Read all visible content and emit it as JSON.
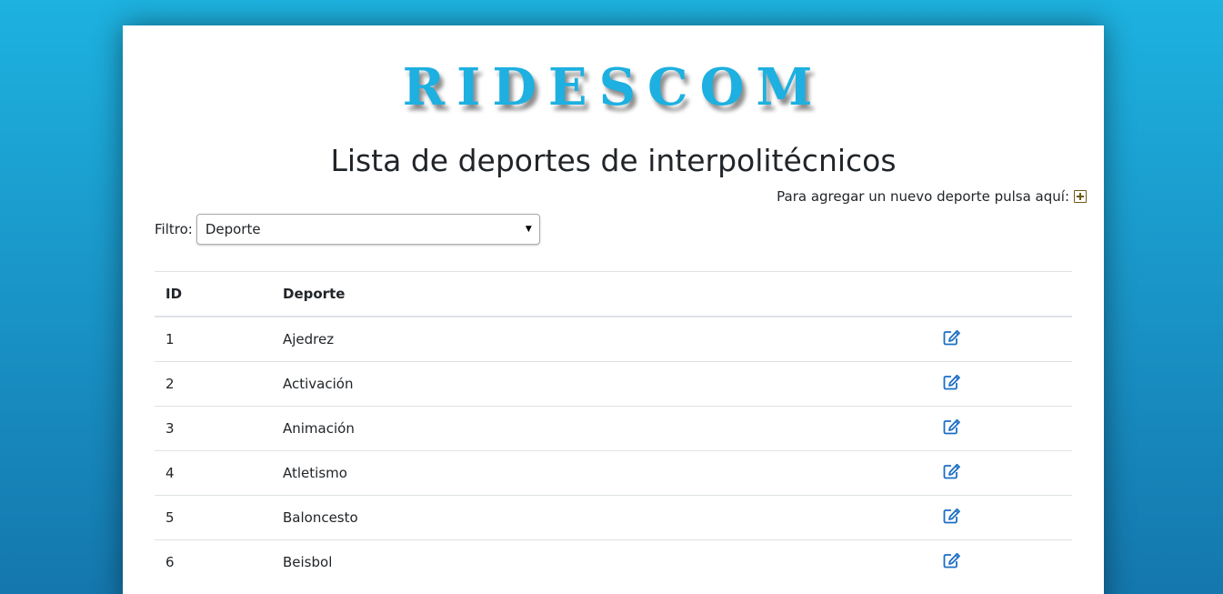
{
  "brand": {
    "logo_text": "RIDESCOM",
    "accent_color": "#1db0e0"
  },
  "header": {
    "title": "Lista de deportes de interpolitécnicos",
    "add_prompt": "Para agregar un nuevo deporte pulsa aquí:",
    "add_icon": "plus-square-icon"
  },
  "filter": {
    "label": "Filtro:",
    "selected": "Deporte"
  },
  "table": {
    "columns": [
      "ID",
      "Deporte",
      ""
    ],
    "rows": [
      {
        "id": "1",
        "deporte": "Ajedrez",
        "action_icon": "edit-icon"
      },
      {
        "id": "2",
        "deporte": "Activación",
        "action_icon": "edit-icon"
      },
      {
        "id": "3",
        "deporte": "Animación",
        "action_icon": "edit-icon"
      },
      {
        "id": "4",
        "deporte": "Atletismo",
        "action_icon": "edit-icon"
      },
      {
        "id": "5",
        "deporte": "Baloncesto",
        "action_icon": "edit-icon"
      },
      {
        "id": "6",
        "deporte": "Beisbol",
        "action_icon": "edit-icon"
      }
    ],
    "edit_icon_color": "#1d6fc4"
  }
}
